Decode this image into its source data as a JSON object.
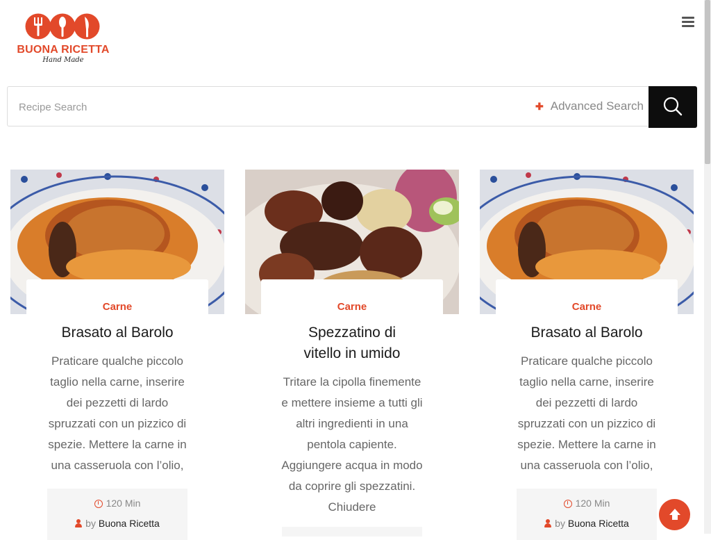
{
  "header": {
    "logo_text": "BUONA RICETTA",
    "logo_subtext": "Hand Made",
    "menu_icon": "hamburger-menu-icon"
  },
  "search": {
    "placeholder": "Recipe Search",
    "advanced_label": "Advanced Search",
    "button_icon": "search-icon"
  },
  "cards": [
    {
      "category": "Carne",
      "title": "Brasato al Barolo",
      "excerpt": "Praticare qualche piccolo taglio nella carne, inserire dei pezzetti di lardo spruzzati con un pizzico di spezie. Mettere la carne in una casseruola con l’olio,",
      "time": "120 Min",
      "by": "by",
      "author": "Buona Ricetta"
    },
    {
      "category": "Carne",
      "title": "Spezzatino di vitello in umido",
      "excerpt": "Tritare la cipolla finemente e mettere insieme a tutti gli altri ingredienti in una pentola capiente. Aggiungere acqua in modo da coprire gli spezzatini. Chiudere"
    },
    {
      "category": "Carne",
      "title": "Brasato al Barolo",
      "excerpt": "Praticare qualche piccolo taglio nella carne, inserire dei pezzetti di lardo spruzzati con un pizzico di spezie. Mettere la carne in una casseruola con l’olio,",
      "time": "120 Min",
      "by": "by",
      "author": "Buona Ricetta"
    }
  ],
  "back_to_top_icon": "arrow-up-icon",
  "colors": {
    "accent": "#e2492a",
    "search_button": "#0d0d0d",
    "meta_bg": "#f5f5f5"
  }
}
